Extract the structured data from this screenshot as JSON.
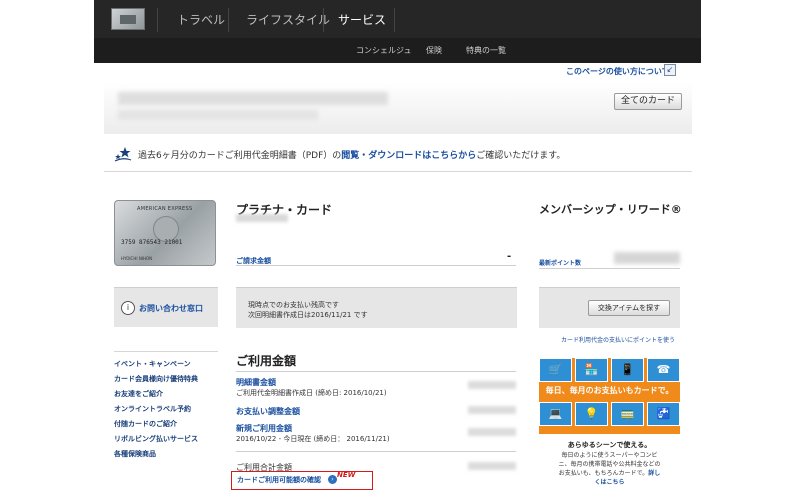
{
  "nav": {
    "tabs": [
      "トラベル",
      "ライフスタイル",
      "サービス"
    ],
    "active_tab": "サービス",
    "subnav": [
      "コンシェルジュ",
      "保険",
      "特典の一覧"
    ]
  },
  "help_link": "このページの使い方について",
  "all_cards_button": "全てのカード",
  "notice": {
    "prefix": "過去6ヶ月分のカードご利用代金明細書（PDF）の",
    "link": "閲覧・ダウンロードはこちらから",
    "suffix": "ご確認いただけます。"
  },
  "card": {
    "brand_text": "AMERICAN EXPRESS",
    "number_text": "3759 876543 21001",
    "holder_text": "HYOICHI NIHON"
  },
  "contact": {
    "label": "お問い合わせ窓口"
  },
  "left_links": [
    "イベント・キャンペーン",
    "カード会員様向け優待特典",
    "お友達をご紹介",
    "オンライントラベル予約",
    "付随カードのご紹介",
    "リボルビング払いサービス",
    "各種保険商品"
  ],
  "platinum": {
    "title": "プラチナ・カード",
    "bill_label": "ご請求金額",
    "bill_value": "-",
    "balance_line1": "現時点でのお支払い残高です",
    "balance_line2": "次回明細書作成日は2016/11/21 です"
  },
  "usage": {
    "title": "ご利用金額",
    "statement_head": "明細書金額",
    "statement_sub": "ご利用代金明細書作成日 (締め日: 2016/10/21)",
    "adjust_head": "お支払い調整金額",
    "new_head": "新規ご利用金額",
    "new_sub": "2016/10/22 - 今日現在 (締め日： 2016/11/21)",
    "total_label": "ご利用合計金額",
    "confirm_link": "カードご利用可能額の確認",
    "new_badge": "NEW"
  },
  "rewards": {
    "title": "メンバーシップ・リワード®",
    "points_label": "最新ポイント数",
    "exchange_button": "交換アイテムを探す",
    "pay_points_link": "カード利用代金の支払いにポイントを使う"
  },
  "promo": {
    "band_text": "毎日、毎月のお支払いもカードで。",
    "caption_title": "あらゆるシーンで使える。",
    "caption_lines": [
      "毎日のように使うスーパーやコンビ",
      "ニ、毎月の携帯電話や公共料金などの",
      "お支払いも、もちろんカードで。"
    ],
    "caption_link_a": "詳し",
    "caption_link_b": "くはこちら"
  },
  "colors": {
    "nav_bg": "#262626",
    "link_blue": "#1a4fa0",
    "promo_orange": "#f08a1a",
    "promo_blue": "#2f8fd4",
    "highlight_red": "#d61a1a"
  }
}
